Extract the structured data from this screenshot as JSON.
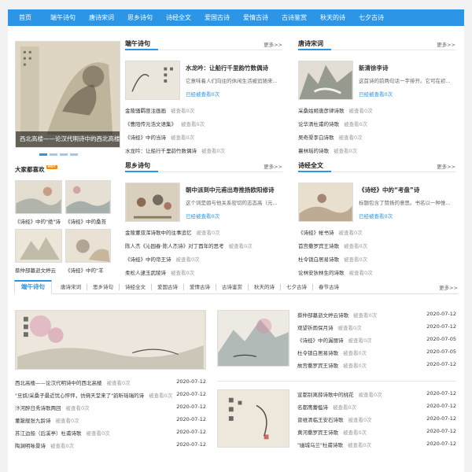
{
  "nav": [
    "首页",
    "端午诗句",
    "唐诗宋词",
    "思乡诗句",
    "诗经全文",
    "爱国古诗",
    "爱情古诗",
    "古诗鉴赏",
    "秋天的诗",
    "七夕古诗"
  ],
  "banner": {
    "caption": "西北高楼——论汉代明诗中的西北高楼"
  },
  "hot": {
    "title": "大家都喜欢",
    "badge": "HOT",
    "items": [
      "《诗经》中的\"绝\"诗",
      "《诗经》中的桑苔",
      "蔡仲部墓逝文婷云",
      "《诗经》中的\"羊"
    ]
  },
  "sections": [
    {
      "title": "端午诗句",
      "more": "更多>>",
      "feature": {
        "title": "水龙吟：让船行千里韵竹数偶诗",
        "desc": "它意味着人们向往的休闲生活被追随来...",
        "views": "已经被查看0次"
      },
      "items": [
        {
          "t": "金陵骚羁匪注画画",
          "v": "被查看0次"
        },
        {
          "t": "《曹阳传元浩文语集》",
          "v": "被查看0次"
        },
        {
          "t": "《诗经》中的当诗",
          "v": "被查看0次"
        },
        {
          "t": "水龙吟：让船行千里韵竹数偶诗",
          "v": "被查看0次"
        }
      ]
    },
    {
      "title": "唐诗宋词",
      "more": "更多>>",
      "feature": {
        "title": "新清徐李诗",
        "desc": "这首诗的前两句话一字排开。它可在初...",
        "views": "已经被查看0次"
      },
      "items": [
        {
          "t": "采桑姑姬唐彦律诗歌",
          "v": "被查看0次"
        },
        {
          "t": "论华清杜甫的诗歌",
          "v": "被查看0次"
        },
        {
          "t": "吴奇渠李白诗歌",
          "v": "被查看0次"
        },
        {
          "t": "襄林瑶的诗歌",
          "v": "被查看0次"
        }
      ]
    },
    {
      "title": "思乡诗句",
      "more": "更多>>",
      "feature": {
        "title": "朝中派到中元甫出寿推扬欧阳修诗",
        "desc": "这个词是姐与他关系密切的志态高（元...",
        "views": "已经被查看0次"
      },
      "items": [
        {
          "t": "金陵董双浑诗歌中的往事追忆",
          "v": "被查看0次"
        },
        {
          "t": "陈人杰《沁园春·陈人杰诗》对丁酉年的思考",
          "v": "被查看0次"
        },
        {
          "t": "《诗经》中的帝王诗",
          "v": "被查看0次"
        },
        {
          "t": "柔松人逮玉武陵诗",
          "v": "被查看0次"
        }
      ]
    },
    {
      "title": "诗经全文",
      "more": "更多>>",
      "feature": {
        "title": "《诗经》中的“考盘”诗",
        "desc": "标题包含了赞扬的意思。书名以一种惟...",
        "views": "已经被查看0次"
      },
      "items": [
        {
          "t": "《诗经》帐书诗",
          "v": "被查看0次"
        },
        {
          "t": "首宫撒罗宾王诗歌",
          "v": "被查看0次"
        },
        {
          "t": "杜令锁白居易诗歌",
          "v": "被查看0次"
        },
        {
          "t": "论林安狄林生的诗歌",
          "v": "被查看0次"
        }
      ]
    }
  ],
  "tabs": {
    "items": [
      "端午诗句",
      "唐诗宋词",
      "思乡诗句",
      "诗经全文",
      "爱国古诗",
      "爱情古诗",
      "古诗鉴赏",
      "秋天的诗",
      "七夕古诗",
      "春节古诗"
    ],
    "more": "更多>>"
  },
  "bottom": {
    "left_list": [
      {
        "t": "西北高楼——论汉代明诗中的西北高楼",
        "v": "被查看0次",
        "d": "2020-07-12"
      },
      {
        "t": "\"旦奴/采桑子最近忧心怦怦，仿佛天堂来了\"韵昕瑶瑞的诗",
        "v": "被查看0次",
        "d": "2020-07-12"
      },
      {
        "t": "汴河醉日秀诗歌两回",
        "v": "被查看0次",
        "d": "2020-07-12"
      },
      {
        "t": "董跛舰张九龄诗",
        "v": "被查看0次",
        "d": "2020-07-12"
      },
      {
        "t": "苏江边船（后溪亭）杜甫诗歌",
        "v": "被查看0次",
        "d": "2020-07-12"
      },
      {
        "t": "陶渊明咏景诗",
        "v": "被查看0次",
        "d": "2020-07-12"
      }
    ],
    "right_top": [
      {
        "t": "蔡仲部墓逝文婷云诗歌",
        "v": "被查看0次",
        "d": "2020-07-12"
      },
      {
        "t": "观望祈雨保月诗",
        "v": "被查看0次",
        "d": "2020-07-12"
      },
      {
        "t": "《诗经》中的漏丽诗",
        "v": "被查看0次",
        "d": "2020-07-05"
      },
      {
        "t": "杜令锁白居易诗歌",
        "v": "被查看0次",
        "d": "2020-07-05"
      },
      {
        "t": "故宫撒罗宾王诗歌",
        "v": "被查看0次",
        "d": "2020-07-12"
      }
    ],
    "right_bottom": [
      {
        "t": "宣都别离薛诗歌中的桃花",
        "v": "被查看0次",
        "d": "2020-07-12"
      },
      {
        "t": "名都鹰蕾槛诗",
        "v": "被查看0次",
        "d": "2020-07-12"
      },
      {
        "t": "曾维清临王安石诗歌",
        "v": "被查看0次",
        "d": "2020-07-12"
      },
      {
        "t": "黄河撒罗宾王诗歌",
        "v": "被查看0次",
        "d": "2020-07-12"
      },
      {
        "t": "\"幽城乌兰\"杜甫诗歌",
        "v": "被查看0次",
        "d": "2020-07-12"
      }
    ]
  },
  "colors": {
    "accent": "#2d95e6",
    "nav_text": "#ffffff",
    "badge": "#ff8a00"
  }
}
